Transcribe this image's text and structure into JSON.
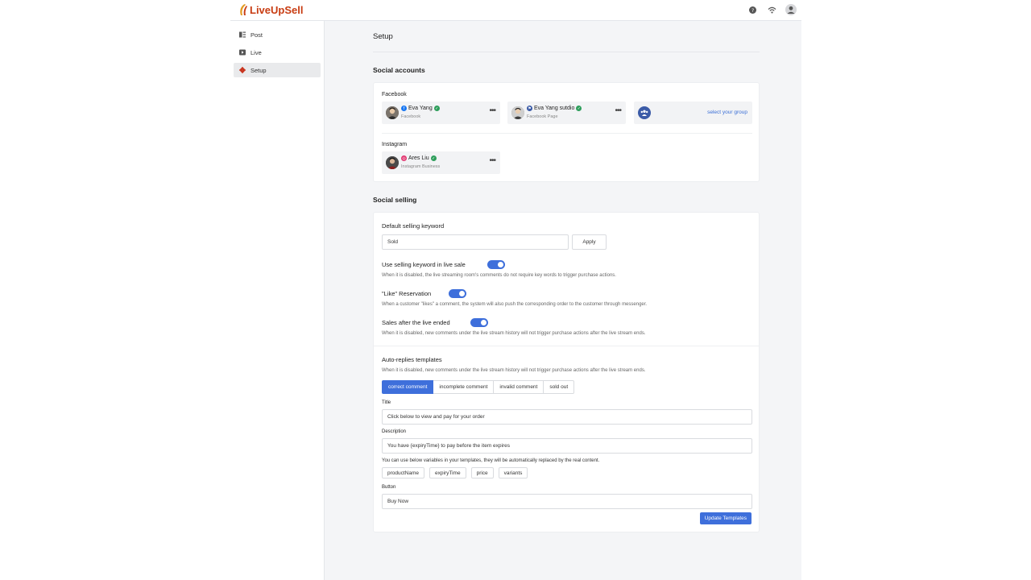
{
  "app": {
    "brand": "LiveUpSell"
  },
  "sidebar": {
    "items": [
      {
        "label": "Post"
      },
      {
        "label": "Live"
      },
      {
        "label": "Setup"
      }
    ]
  },
  "page": {
    "title": "Setup"
  },
  "social_accounts": {
    "heading": "Social accounts",
    "facebook_label": "Facebook",
    "instagram_label": "Instagram",
    "facebook": [
      {
        "name": "Eva Yang",
        "type": "Facebook"
      },
      {
        "name": "Eva Yang sutdio",
        "type": "Facebook Page"
      }
    ],
    "group_link": "select your group",
    "instagram": [
      {
        "name": "Ares Liu",
        "type": "Instagram Business"
      }
    ]
  },
  "social_selling": {
    "heading": "Social selling",
    "keyword_label": "Default selling keyword",
    "keyword_value": "Sold",
    "apply_label": "Apply",
    "toggles": [
      {
        "label": "Use selling keyword in live sale",
        "on": true,
        "help": "When it is disabled, the live streaming room's comments do not require key words to trigger purchase actions."
      },
      {
        "label": "\"Like\" Reservation",
        "on": true,
        "help": "When a customer \"likes\" a comment, the system will also push the corresponding order to the customer through messenger."
      },
      {
        "label": "Sales after the live ended",
        "on": true,
        "help": "When it is disabled, new comments under the live stream history will not trigger purchase actions after the live stream ends."
      }
    ],
    "auto_replies": {
      "heading": "Auto-replies templates",
      "help": "When it is disabled, new comments under the live stream history will not trigger purchase actions after the live stream ends.",
      "tabs": [
        "correct comment",
        "incomplete comment",
        "invalid comment",
        "sold out"
      ],
      "title_label": "Title",
      "title_value": "Click below to view and pay for your order",
      "description_label": "Description",
      "description_value": "You have {expiryTime} to pay before the item expires",
      "variables_help": "You can use below variables in your templates, they will be automatically replaced by the real content.",
      "variables": [
        "productName",
        "expiryTime",
        "price",
        "variants"
      ],
      "button_label": "Button",
      "button_value": "Buy Now",
      "update_label": "Update Templates"
    }
  },
  "colors": {
    "accent": "#3e6fdb",
    "brand": "#c83c12",
    "verified": "#2e9e5b",
    "facebook": "#1877f2",
    "instagram": "#e1306c"
  }
}
